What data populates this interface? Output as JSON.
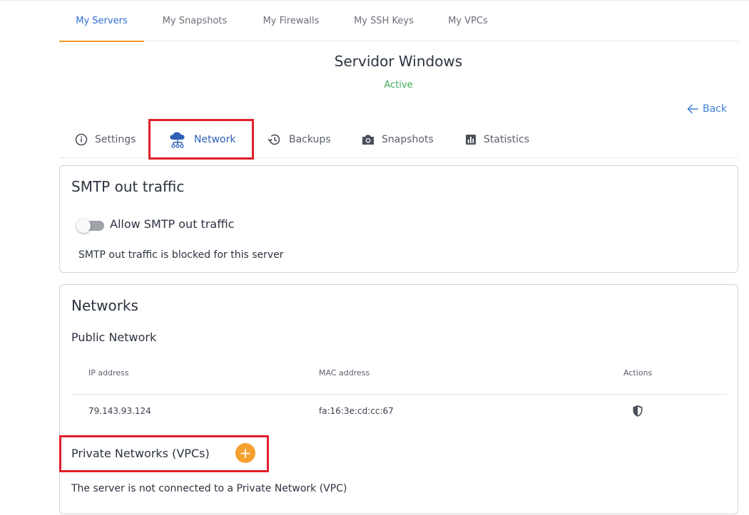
{
  "top_tabs": [
    {
      "label": "My Servers",
      "active": true
    },
    {
      "label": "My Snapshots",
      "active": false
    },
    {
      "label": "My Firewalls",
      "active": false
    },
    {
      "label": "My SSH Keys",
      "active": false
    },
    {
      "label": "My VPCs",
      "active": false
    }
  ],
  "server": {
    "name": "Servidor Windows",
    "status": "Active"
  },
  "back_label": "Back",
  "section_tabs": [
    {
      "label": "Settings",
      "icon": "info-circle-icon"
    },
    {
      "label": "Network",
      "icon": "cloud-network-icon",
      "active": true
    },
    {
      "label": "Backups",
      "icon": "history-icon"
    },
    {
      "label": "Snapshots",
      "icon": "camera-icon"
    },
    {
      "label": "Statistics",
      "icon": "bar-chart-icon"
    }
  ],
  "smtp": {
    "title": "SMTP out traffic",
    "toggle_label": "Allow SMTP out traffic",
    "toggle_on": false,
    "note": "SMTP out traffic is blocked for this server"
  },
  "networks": {
    "title": "Networks",
    "public_title": "Public Network",
    "columns": [
      "IP address",
      "MAC address",
      "Actions"
    ],
    "rows": [
      {
        "ip": "79.143.93.124",
        "mac": "fa:16:3e:cd:cc:67",
        "action_icon": "shield-icon"
      }
    ],
    "private_title": "Private Networks (VPCs)",
    "add_label": "+",
    "private_note": "The server is not connected to a Private Network (VPC)"
  },
  "colors": {
    "accent_blue": "#2f6fcf",
    "active_green": "#3eaa55",
    "orange": "#f6a030",
    "highlight_red": "#e0202b"
  }
}
